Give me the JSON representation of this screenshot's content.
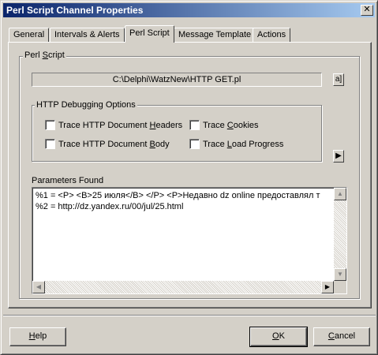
{
  "window": {
    "title": "Perl Script Channel Properties",
    "close_symbol": "✕"
  },
  "tabs": [
    {
      "label": "General",
      "active": false
    },
    {
      "label": "Intervals & Alerts",
      "active": false
    },
    {
      "label": "Perl Script",
      "active": true
    },
    {
      "label": "Message Template",
      "active": false
    },
    {
      "label": "Actions",
      "active": false
    }
  ],
  "perl_script": {
    "group_pre": "Perl ",
    "group_u": "S",
    "group_post": "cript",
    "path": "C:\\Delphi\\WatzNew\\HTTP GET.pl",
    "browse_button": "a]"
  },
  "http_debug": {
    "group_label": "HTTP Debugging Options",
    "options": [
      {
        "pre": "Trace HTTP Document ",
        "u": "H",
        "post": "eaders"
      },
      {
        "pre": "Trace ",
        "u": "C",
        "post": "ookies"
      },
      {
        "pre": "Trace HTTP Document ",
        "u": "B",
        "post": "ody"
      },
      {
        "pre": "Trace ",
        "u": "L",
        "post": "oad Progress"
      }
    ],
    "arrow_button": "▶"
  },
  "parameters": {
    "label": "Parameters Found",
    "lines": [
      "%1 = <P> <B>25 июля</B> </P> <P>Недавно dz online предоставлял т",
      "%2 = http://dz.yandex.ru/00/jul/25.html"
    ]
  },
  "scroll_glyphs": {
    "up": "▲",
    "down": "▼",
    "left": "◀",
    "right": "▶"
  },
  "buttons": {
    "help": "Help",
    "help_u": "H",
    "ok": "OK",
    "ok_u": "O",
    "cancel": "Cancel",
    "cancel_u": "C"
  }
}
